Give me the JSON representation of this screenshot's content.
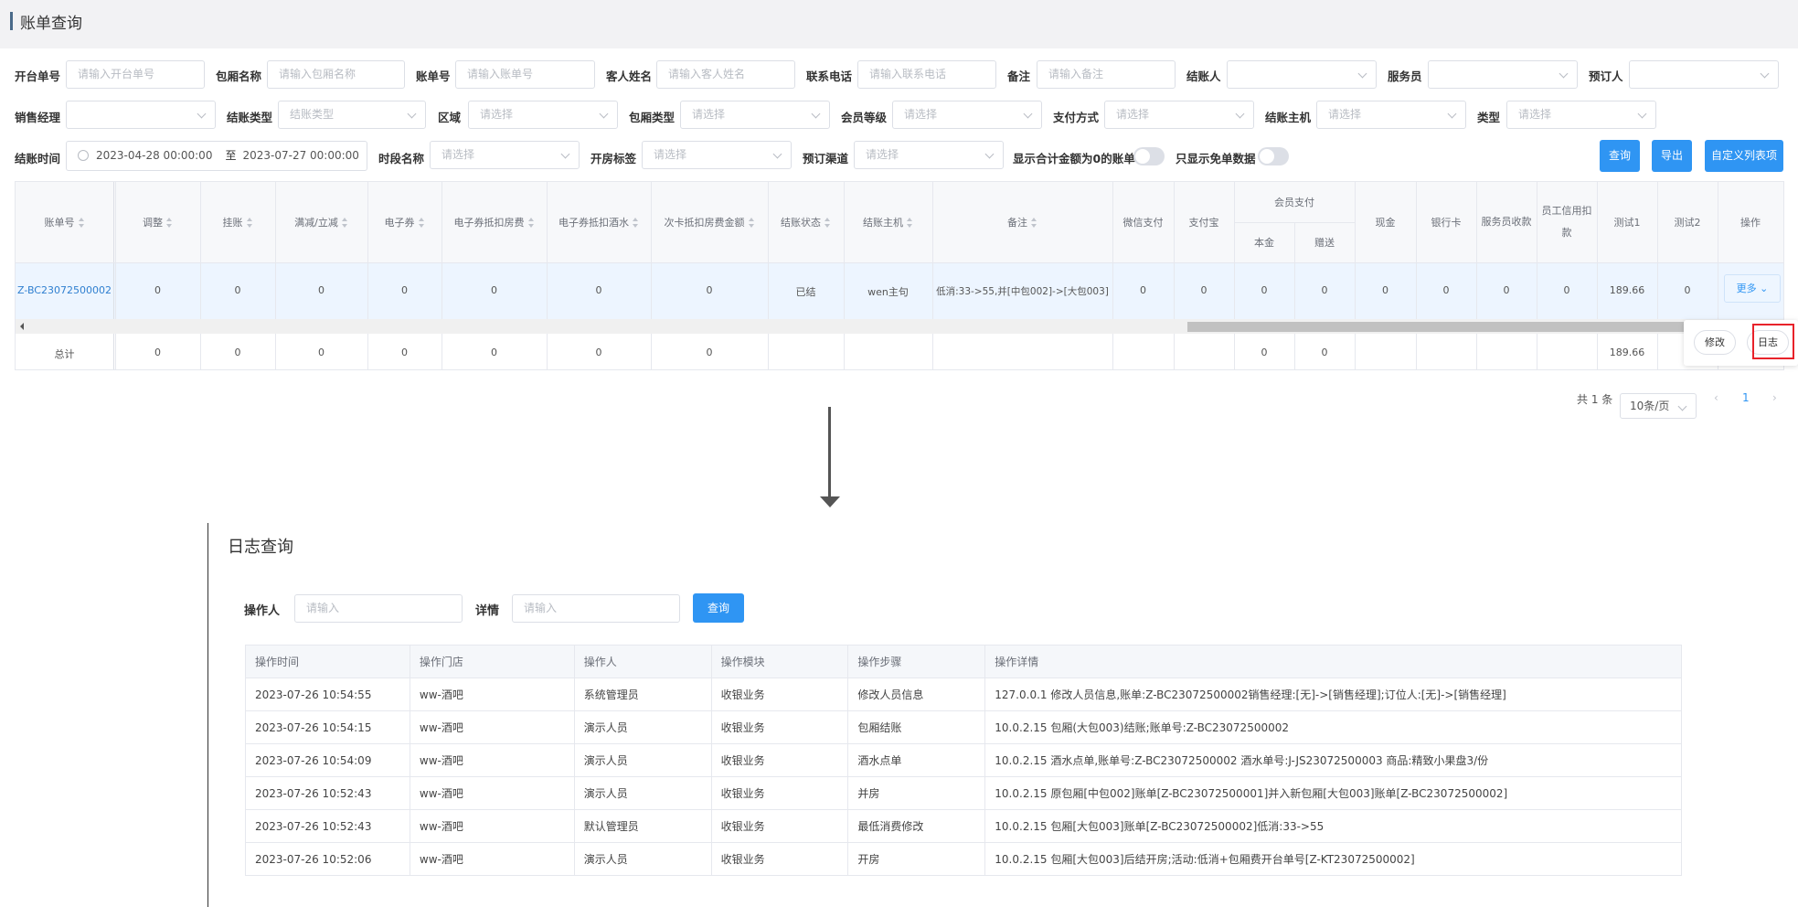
{
  "page": {
    "title": "账单查询"
  },
  "filters": {
    "row1": [
      {
        "label": "开台单号",
        "placeholder": "请输入开台单号"
      },
      {
        "label": "包厢名称",
        "placeholder": "请输入包厢名称"
      },
      {
        "label": "账单号",
        "placeholder": "请输入账单号"
      },
      {
        "label": "客人姓名",
        "placeholder": "请输入客人姓名"
      },
      {
        "label": "联系电话",
        "placeholder": "请输入联系电话"
      },
      {
        "label": "备注",
        "placeholder": "请输入备注"
      },
      {
        "label": "结账人",
        "placeholder": ""
      },
      {
        "label": "服务员",
        "placeholder": ""
      },
      {
        "label": "预订人",
        "placeholder": ""
      }
    ],
    "row2": [
      {
        "label": "销售经理",
        "placeholder": ""
      },
      {
        "label": "结账类型",
        "placeholder": "结账类型"
      },
      {
        "label": "区域",
        "placeholder": "请选择"
      },
      {
        "label": "包厢类型",
        "placeholder": "请选择"
      },
      {
        "label": "会员等级",
        "placeholder": "请选择"
      },
      {
        "label": "支付方式",
        "placeholder": "请选择"
      },
      {
        "label": "结账主机",
        "placeholder": "请选择"
      },
      {
        "label": "类型",
        "placeholder": "请选择"
      }
    ],
    "row3": {
      "checkout_time_label": "结账时间",
      "date_start": "2023-04-28 00:00:00",
      "date_sep": "至",
      "date_end": "2023-07-27 00:00:00",
      "period_label": "时段名称",
      "period_placeholder": "请选择",
      "room_tag_label": "开房标签",
      "room_tag_placeholder": "请选择",
      "channel_label": "预订渠道",
      "channel_placeholder": "请选择",
      "switch1_label": "显示合计金额为0的账单",
      "switch2_label": "只显示免单数据"
    },
    "buttons": {
      "query": "查询",
      "export": "导出",
      "custom_columns": "自定义列表项"
    }
  },
  "table": {
    "headers": [
      "账单号",
      "调整",
      "挂账",
      "满减/立减",
      "电子券",
      "电子券抵扣房费",
      "电子券抵扣酒水",
      "次卡抵扣房费金额",
      "结账状态",
      "结账主机",
      "备注",
      "微信支付",
      "支付宝",
      "会员支付",
      "本金",
      "赠送",
      "现金",
      "银行卡",
      "服务员收款",
      "员工信用扣款",
      "测试1",
      "测试2",
      "操作"
    ],
    "row": [
      "Z-BC23072500002",
      "0",
      "0",
      "0",
      "0",
      "0",
      "0",
      "0",
      "已结",
      "wen主句",
      "低消:33->55,并[中包002]->[大包003]",
      "0",
      "0",
      "0",
      "0",
      "0",
      "0",
      "0",
      "0",
      "189.66",
      "0"
    ],
    "more_label": "更多",
    "total": [
      "总计",
      "0",
      "0",
      "0",
      "0",
      "0",
      "0",
      "0",
      "0",
      "0",
      "189.66"
    ],
    "popover": {
      "edit": "修改",
      "log": "日志"
    }
  },
  "pagination": {
    "total_text": "共 1 条",
    "page_size": "10条/页",
    "current_page": "1"
  },
  "log": {
    "title": "日志查询",
    "operator_label": "操作人",
    "operator_placeholder": "请输入",
    "detail_label": "详情",
    "detail_placeholder": "请输入",
    "query_button": "查询",
    "headers": [
      "操作时间",
      "操作门店",
      "操作人",
      "操作模块",
      "操作步骤",
      "操作详情"
    ],
    "rows": [
      [
        "2023-07-26 10:54:55",
        "ww-酒吧",
        "系统管理员",
        "收银业务",
        "修改人员信息",
        "127.0.0.1 修改人员信息,账单:Z-BC23072500002销售经理:[无]->[销售经理];订位人:[无]->[销售经理]"
      ],
      [
        "2023-07-26 10:54:15",
        "ww-酒吧",
        "演示人员",
        "收银业务",
        "包厢结账",
        "10.0.2.15 包厢(大包003)结账;账单号:Z-BC23072500002"
      ],
      [
        "2023-07-26 10:54:09",
        "ww-酒吧",
        "演示人员",
        "收银业务",
        "酒水点单",
        "10.0.2.15 酒水点单,账单号:Z-BC23072500002 酒水单号:J-JS23072500003 商品:精致小果盘3/份"
      ],
      [
        "2023-07-26 10:52:43",
        "ww-酒吧",
        "演示人员",
        "收银业务",
        "并房",
        "10.0.2.15 原包厢[中包002]账单[Z-BC23072500001]并入新包厢[大包003]账单[Z-BC23072500002]"
      ],
      [
        "2023-07-26 10:52:43",
        "ww-酒吧",
        "默认管理员",
        "收银业务",
        "最低消费修改",
        "10.0.2.15 包厢[大包003]账单[Z-BC23072500002]低消:33->55"
      ],
      [
        "2023-07-26 10:52:06",
        "ww-酒吧",
        "演示人员",
        "收银业务",
        "开房",
        "10.0.2.15 包厢[大包003]后结开房;活动:低消+包厢费开台单号[Z-KT23072500002]"
      ]
    ]
  },
  "colors": {
    "primary": "#2f95f3",
    "highlight": "#e8222a",
    "header_bg": "#f2f2f4"
  },
  "icons": [
    "clock-icon",
    "chevron-down-icon",
    "sort-icon",
    "arrow-down-icon",
    "chevron-left-icon",
    "chevron-right-icon"
  ]
}
